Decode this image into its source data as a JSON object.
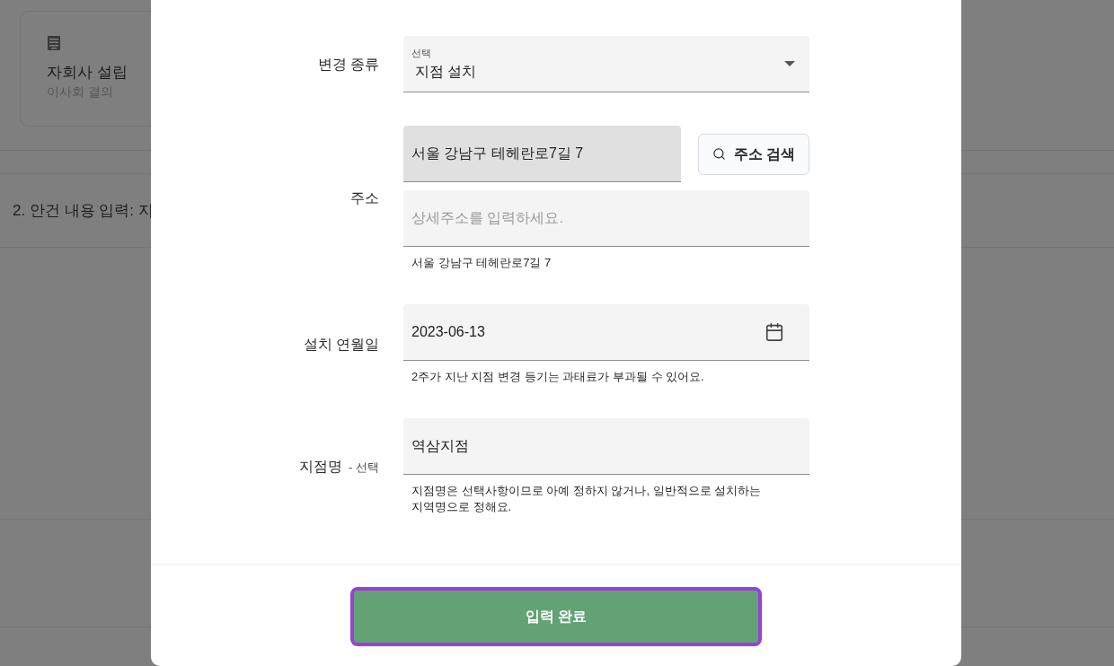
{
  "backdrop": {
    "card": {
      "title": "자회사 설립",
      "subtitle": "이사회 결의"
    },
    "section_heading": "2. 안건 내용 입력: 지"
  },
  "form": {
    "fields": [
      {
        "kind": "select",
        "label": "변경 종류",
        "floating_label": "선택",
        "value": "지점 설치"
      },
      {
        "kind": "address",
        "label": "주소",
        "value": "서울 강남구 테헤란로7길 7",
        "readonly": true,
        "search_button": "주소 검색",
        "detail_placeholder": "상세주소를 입력하세요.",
        "helper": "서울 강남구 테헤란로7길 7"
      },
      {
        "kind": "date",
        "label": "설치 연월일",
        "value": "2023-06-13",
        "helper": "2주가 지난 지점 변경 등기는 과태료가 부과될 수 있어요."
      },
      {
        "kind": "text",
        "label": "지점명",
        "label_note": "- 선택",
        "value": "역삼지점",
        "helper": "지점명은 선택사항이므로 아예 정하지 않거나, 일반적으로 설치하는 지역명으로 정해요."
      }
    ]
  },
  "submit_button": {
    "label": "입력 완료",
    "focused": true
  }
}
